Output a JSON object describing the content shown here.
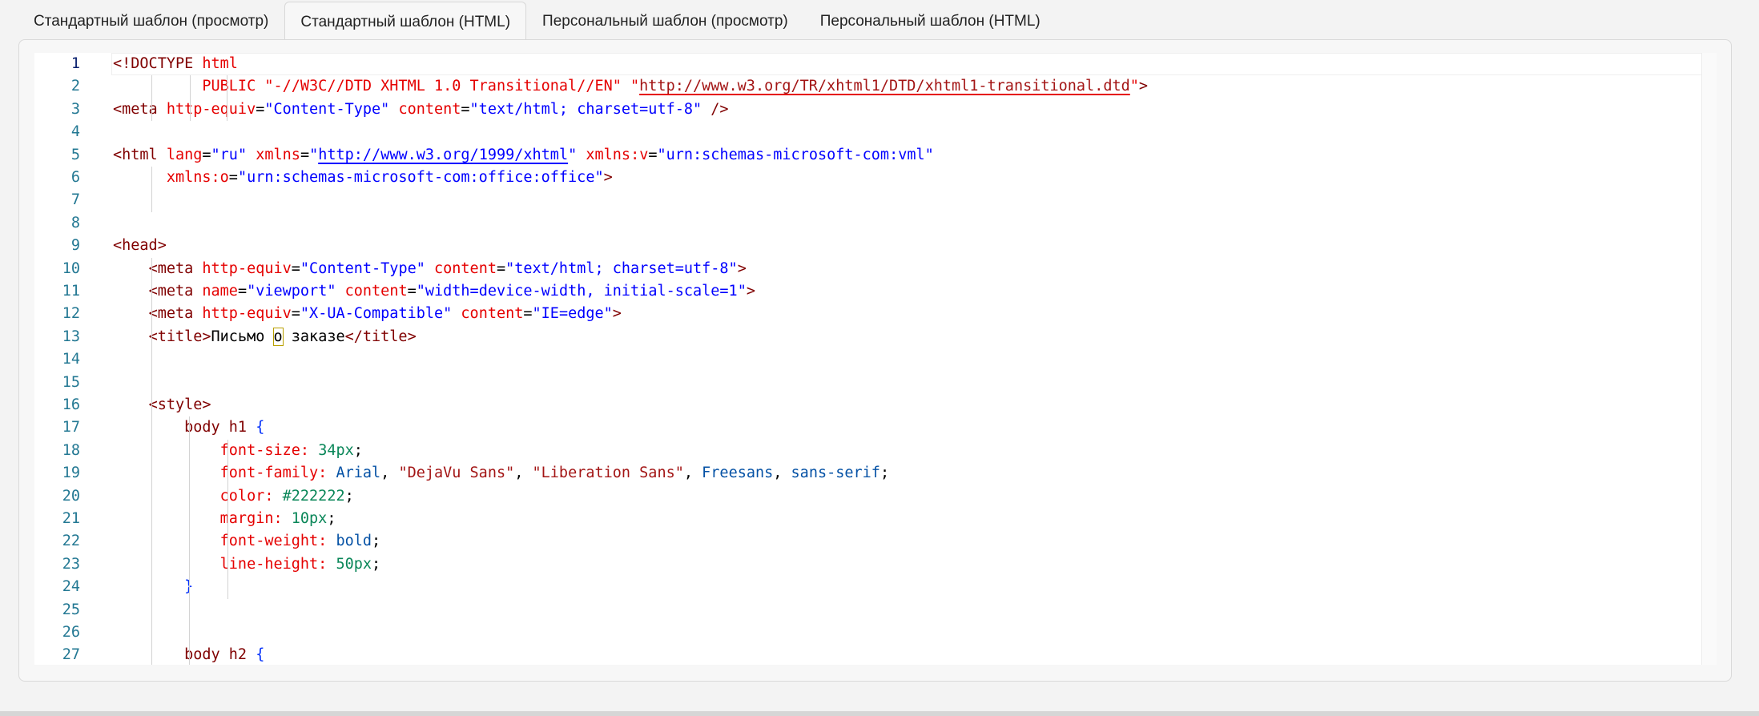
{
  "tabs": [
    {
      "label": "Стандартный шаблон (просмотр)",
      "active": false
    },
    {
      "label": "Стандартный шаблон (HTML)",
      "active": true
    },
    {
      "label": "Персональный шаблон (просмотр)",
      "active": false
    },
    {
      "label": "Персональный шаблон (HTML)",
      "active": false
    }
  ],
  "editor": {
    "current_line": 1,
    "line_numbers": [
      "1",
      "2",
      "3",
      "4",
      "5",
      "6",
      "7",
      "8",
      "9",
      "10",
      "11",
      "12",
      "13",
      "14",
      "15",
      "16",
      "17",
      "18",
      "19",
      "20",
      "21",
      "22",
      "23",
      "24",
      "25",
      "26",
      "27"
    ],
    "lines": [
      [
        [
          "doc",
          "<!DOCTYPE "
        ],
        [
          "doc2",
          "html"
        ]
      ],
      [
        [
          "doc2",
          "          PUBLIC "
        ],
        [
          "doc2",
          "\"-//W3C//DTD XHTML 1.0 Transitional//EN\" \""
        ],
        [
          "urlred",
          "http://www.w3.org/TR/xhtml1/DTD/xhtml1-transitional.dtd"
        ],
        [
          "doc2",
          "\""
        ],
        [
          "doc",
          ">"
        ]
      ],
      [
        [
          "tag",
          "<meta "
        ],
        [
          "attr",
          "http-equiv"
        ],
        [
          "plain",
          "="
        ],
        [
          "val",
          "\"Content-Type\""
        ],
        [
          "plain",
          " "
        ],
        [
          "attr",
          "content"
        ],
        [
          "plain",
          "="
        ],
        [
          "val",
          "\"text/html; charset=utf-8\""
        ],
        [
          "plain",
          " "
        ],
        [
          "tag",
          "/>"
        ]
      ],
      [],
      [
        [
          "tag",
          "<html "
        ],
        [
          "attr",
          "lang"
        ],
        [
          "plain",
          "="
        ],
        [
          "val",
          "\"ru\""
        ],
        [
          "plain",
          " "
        ],
        [
          "attr",
          "xmlns"
        ],
        [
          "plain",
          "="
        ],
        [
          "val",
          "\""
        ],
        [
          "urlblue",
          "http://www.w3.org/1999/xhtml"
        ],
        [
          "val",
          "\""
        ],
        [
          "plain",
          " "
        ],
        [
          "attr",
          "xmlns:v"
        ],
        [
          "plain",
          "="
        ],
        [
          "val",
          "\"urn:schemas-microsoft-com:vml\""
        ]
      ],
      [
        [
          "plain",
          "      "
        ],
        [
          "attr",
          "xmlns:o"
        ],
        [
          "plain",
          "="
        ],
        [
          "val",
          "\"urn:schemas-microsoft-com:office:office\""
        ],
        [
          "tag",
          ">"
        ]
      ],
      [],
      [],
      [
        [
          "tag",
          "<head>"
        ]
      ],
      [
        [
          "plain",
          "    "
        ],
        [
          "tag",
          "<meta "
        ],
        [
          "attr",
          "http-equiv"
        ],
        [
          "plain",
          "="
        ],
        [
          "val",
          "\"Content-Type\""
        ],
        [
          "plain",
          " "
        ],
        [
          "attr",
          "content"
        ],
        [
          "plain",
          "="
        ],
        [
          "val",
          "\"text/html; charset=utf-8\""
        ],
        [
          "tag",
          ">"
        ]
      ],
      [
        [
          "plain",
          "    "
        ],
        [
          "tag",
          "<meta "
        ],
        [
          "attr",
          "name"
        ],
        [
          "plain",
          "="
        ],
        [
          "val",
          "\"viewport\""
        ],
        [
          "plain",
          " "
        ],
        [
          "attr",
          "content"
        ],
        [
          "plain",
          "="
        ],
        [
          "val",
          "\"width=device-width, initial-scale=1\""
        ],
        [
          "tag",
          ">"
        ]
      ],
      [
        [
          "plain",
          "    "
        ],
        [
          "tag",
          "<meta "
        ],
        [
          "attr",
          "http-equiv"
        ],
        [
          "plain",
          "="
        ],
        [
          "val",
          "\"X-UA-Compatible\""
        ],
        [
          "plain",
          " "
        ],
        [
          "attr",
          "content"
        ],
        [
          "plain",
          "="
        ],
        [
          "val",
          "\"IE=edge\""
        ],
        [
          "tag",
          ">"
        ]
      ],
      [
        [
          "plain",
          "    "
        ],
        [
          "tag",
          "<title>"
        ],
        [
          "plain",
          "Письмо "
        ],
        [
          "bracket",
          "о"
        ],
        [
          "plain",
          " заказе"
        ],
        [
          "tag",
          "</title>"
        ]
      ],
      [],
      [],
      [
        [
          "plain",
          "    "
        ],
        [
          "tag",
          "<style>"
        ]
      ],
      [
        [
          "plain",
          "        "
        ],
        [
          "sel",
          "body h1 "
        ],
        [
          "brace",
          "{"
        ]
      ],
      [
        [
          "plain",
          "            "
        ],
        [
          "prop",
          "font-size: "
        ],
        [
          "num",
          "34px"
        ],
        [
          "plain",
          ";"
        ]
      ],
      [
        [
          "plain",
          "            "
        ],
        [
          "prop",
          "font-family: "
        ],
        [
          "kw",
          "Arial"
        ],
        [
          "plain",
          ", "
        ],
        [
          "str",
          "\"DejaVu Sans\""
        ],
        [
          "plain",
          ", "
        ],
        [
          "str",
          "\"Liberation Sans\""
        ],
        [
          "plain",
          ", "
        ],
        [
          "kw",
          "Freesans"
        ],
        [
          "plain",
          ", "
        ],
        [
          "kw",
          "sans-serif"
        ],
        [
          "plain",
          ";"
        ]
      ],
      [
        [
          "plain",
          "            "
        ],
        [
          "prop",
          "color: "
        ],
        [
          "num",
          "#222222"
        ],
        [
          "plain",
          ";"
        ]
      ],
      [
        [
          "plain",
          "            "
        ],
        [
          "prop",
          "margin: "
        ],
        [
          "num",
          "10px"
        ],
        [
          "plain",
          ";"
        ]
      ],
      [
        [
          "plain",
          "            "
        ],
        [
          "prop",
          "font-weight: "
        ],
        [
          "kw",
          "bold"
        ],
        [
          "plain",
          ";"
        ]
      ],
      [
        [
          "plain",
          "            "
        ],
        [
          "prop",
          "line-height: "
        ],
        [
          "num",
          "50px"
        ],
        [
          "plain",
          ";"
        ]
      ],
      [
        [
          "plain",
          "        "
        ],
        [
          "brace",
          "}"
        ]
      ],
      [],
      [],
      [
        [
          "plain",
          "        "
        ],
        [
          "sel",
          "body h2 "
        ],
        [
          "brace",
          "{"
        ]
      ]
    ]
  },
  "icons": {
    "minimize": "minimize-icon"
  }
}
